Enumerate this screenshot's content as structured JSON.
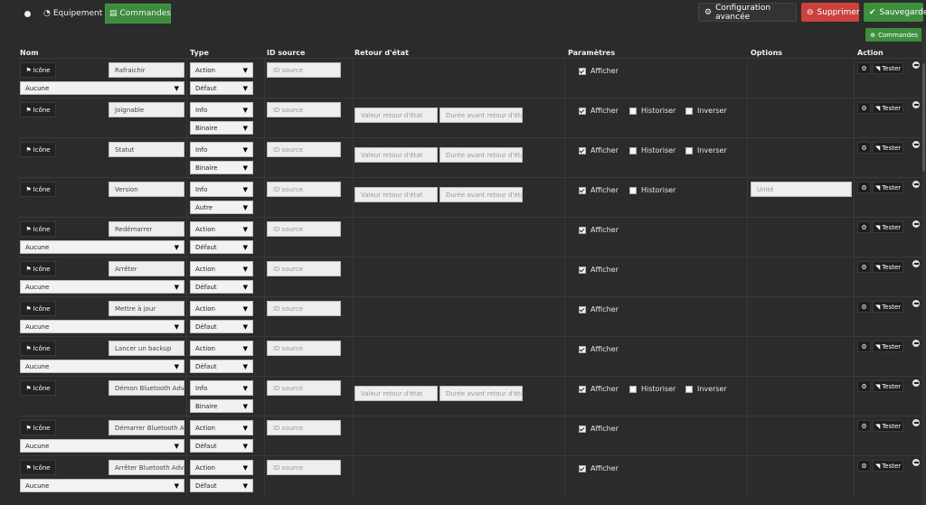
{
  "topbar": {
    "tabs": [
      {
        "label": ""
      },
      {
        "label": "Equipement"
      },
      {
        "label": "Commandes"
      }
    ],
    "buttons": {
      "config": "Configuration avancée",
      "delete": "Supprimer",
      "save": "Sauvegarder"
    },
    "add_command": "Commandes"
  },
  "columns": {
    "nom": "Nom",
    "type": "Type",
    "id_source": "ID source",
    "retour": "Retour d'état",
    "params": "Paramètres",
    "options": "Options",
    "action": "Action"
  },
  "labels": {
    "icon_btn": "Icône",
    "id_placeholder": "ID source",
    "retour_placeholder": "Valeur retour d'état",
    "duree_placeholder": "Durée avant retour d'état",
    "unite_placeholder": "Unité",
    "afficher": "Afficher",
    "historiser": "Historiser",
    "inverser": "Inverser",
    "tester": "Tester"
  },
  "rows": [
    {
      "name": "Rafraichir",
      "type": "Action",
      "subtype": "Défaut",
      "linked": "Aucune",
      "info": false,
      "hist": false,
      "inv": false,
      "unite": false
    },
    {
      "name": "Joignable",
      "type": "Info",
      "subtype": "Binaire",
      "linked": "",
      "info": true,
      "hist": true,
      "inv": true,
      "unite": false
    },
    {
      "name": "Statut",
      "type": "Info",
      "subtype": "Binaire",
      "linked": "",
      "info": true,
      "hist": true,
      "inv": true,
      "unite": false
    },
    {
      "name": "Version",
      "type": "Info",
      "subtype": "Autre",
      "linked": "",
      "info": true,
      "hist": true,
      "inv": false,
      "unite": true
    },
    {
      "name": "Redémarrer",
      "type": "Action",
      "subtype": "Défaut",
      "linked": "Aucune",
      "info": false,
      "hist": false,
      "inv": false,
      "unite": false
    },
    {
      "name": "Arrêter",
      "type": "Action",
      "subtype": "Défaut",
      "linked": "Aucune",
      "info": false,
      "hist": false,
      "inv": false,
      "unite": false
    },
    {
      "name": "Mettre à jour",
      "type": "Action",
      "subtype": "Défaut",
      "linked": "Aucune",
      "info": false,
      "hist": false,
      "inv": false,
      "unite": false
    },
    {
      "name": "Lancer un backup",
      "type": "Action",
      "subtype": "Défaut",
      "linked": "Aucune",
      "info": false,
      "hist": false,
      "inv": false,
      "unite": false
    },
    {
      "name": "Démon Bluetooth Adv",
      "type": "Info",
      "subtype": "Binaire",
      "linked": "",
      "info": true,
      "hist": true,
      "inv": true,
      "unite": false
    },
    {
      "name": "Démarrer Bluetooth Adv",
      "type": "Action",
      "subtype": "Défaut",
      "linked": "Aucune",
      "info": false,
      "hist": false,
      "inv": false,
      "unite": false
    },
    {
      "name": "Arrêter Bluetooth Adv",
      "type": "Action",
      "subtype": "Défaut",
      "linked": "Aucune",
      "info": false,
      "hist": false,
      "inv": false,
      "unite": false
    }
  ]
}
